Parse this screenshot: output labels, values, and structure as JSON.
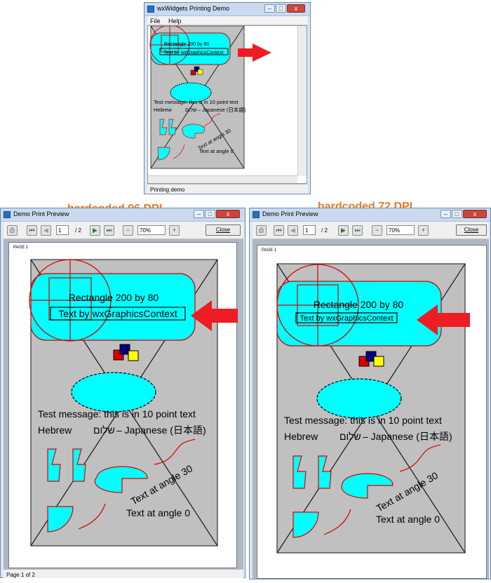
{
  "main_window": {
    "title": "wxWidgets Printing Demo",
    "menu": [
      "File",
      "Help"
    ],
    "status": "Printing demo"
  },
  "drawing": {
    "rect_label": "Rectangle 200 by 80",
    "gc_label": "Text by wxGraphicsContext",
    "message": "Test message: this is in 10 point text",
    "hebrew_prefix": "Hebrew",
    "hebrew_word": "שלום",
    "japanese": "– Japanese (日本語)",
    "angle30": "Text at angle 30",
    "angle0": "Text at angle 0"
  },
  "preview_left": {
    "annotation": "hardcoded 96 DPI",
    "title": "Demo Print Preview",
    "page_input": "1",
    "page_total": "/ 2",
    "zoom": "70%",
    "close": "Close",
    "page_label": "PAGE 1",
    "status": "Page 1 of 2"
  },
  "preview_right": {
    "annotation": "hardcoded 72 DPI",
    "title": "Demo Print Preview",
    "page_input": "1",
    "page_total": "/ 2",
    "zoom": "70%",
    "close": "Close",
    "page_label": "PAGE 1"
  },
  "colors": {
    "cyan": "#00ffff",
    "red_arrow": "#ee1c24",
    "annotation": "#f07820",
    "canvas": "#c0c0c0"
  }
}
